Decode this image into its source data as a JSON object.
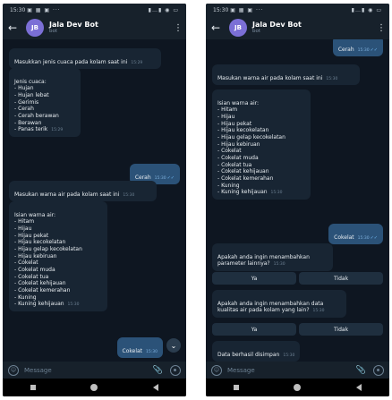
{
  "status_time": "15:30",
  "status_icons": "▣ ▦ ▣ ···",
  "status_right": "▮…▮ ◉ ▭",
  "bot": {
    "name": "Jala Dev Bot",
    "role": "bot",
    "initials": "JB",
    "avatar_color": "#7b6fd6"
  },
  "input_placeholder": "Message",
  "left": {
    "m1": {
      "text": "Masukkan jenis cuaca pada kolam saat ini",
      "time": "15:29"
    },
    "m2": {
      "text": "Jenis cuaca:\n- Hujan\n- Hujan lebat\n- Gerimis\n- Cerah\n- Cerah berawan\n- Berawan\n- Panas terik",
      "time": "15:29"
    },
    "m3": {
      "text": "Cerah",
      "time": "15:30"
    },
    "m4": {
      "text": "Masukan warna air pada kolam saat ini",
      "time": "15:30"
    },
    "m5": {
      "text": "Isian warna air:\n- Hitam\n- Hijau\n- Hijau pekat\n- Hijau kecokelatan\n- Hijau gelap kecokelatan\n- Hijau kebiruan\n- Cokelat\n- Cokelat muda\n- Cokelat tua\n- Cokelat kehijauan\n- Cokelat kemerahan\n- Kuning\n- Kuning kehijauan",
      "time": "15:30"
    },
    "m6": {
      "text": "Cokelat",
      "time": "15:30"
    }
  },
  "right": {
    "m1": {
      "text": "Cerah",
      "time": "15:30"
    },
    "m2": {
      "text": "Masukan warna air pada kolam saat ini",
      "time": "15:30"
    },
    "m3": {
      "text": "Isian warna air:\n- Hitam\n- Hijau\n- Hijau pekat\n- Hijau kecokelatan\n- Hijau gelap kecokelatan\n- Hijau kebiruan\n- Cokelat\n- Cokelat muda\n- Cokelat tua\n- Cokelat kehijauan\n- Cokelat kemerahan\n- Kuning\n- Kuning kehijauan",
      "time": "15:30"
    },
    "m4": {
      "text": "Cokelat",
      "time": "15:30"
    },
    "m5": {
      "text": "Apakah anda ingin menambahkan parameter lainnya?",
      "time": "15:30"
    },
    "k1": {
      "yes": "Ya",
      "no": "Tidak"
    },
    "m6": {
      "text": "Apakah anda ingin menambahkan data kualitas air pada kolam yang lain?",
      "time": "15:30"
    },
    "k2": {
      "yes": "Ya",
      "no": "Tidak"
    },
    "m7": {
      "text": "Data berhasil disimpan",
      "time": "15:30"
    }
  }
}
